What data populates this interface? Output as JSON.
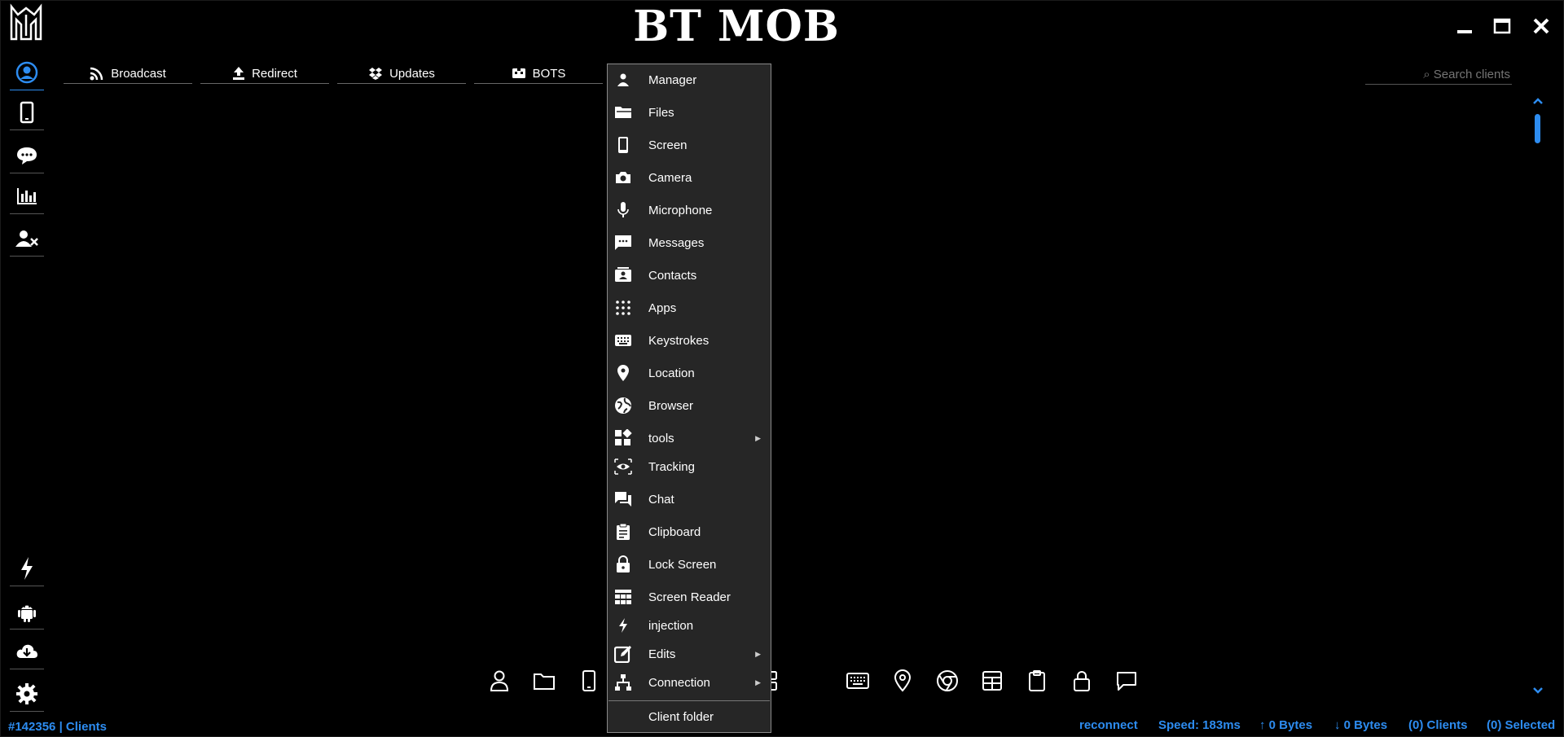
{
  "app": {
    "title": "BT MOB"
  },
  "tabs": [
    {
      "label": "Broadcast",
      "icon": "rss-icon"
    },
    {
      "label": "Redirect",
      "icon": "upload-icon"
    },
    {
      "label": "Updates",
      "icon": "dropbox-icon"
    },
    {
      "label": "BOTS",
      "icon": "bots-icon"
    }
  ],
  "search": {
    "placeholder": "⌕ Search clients"
  },
  "sidebar": {
    "top": [
      {
        "name": "clients",
        "icon": "user-circle-icon",
        "active": true
      },
      {
        "name": "devices",
        "icon": "phone-icon"
      },
      {
        "name": "chat",
        "icon": "chat-bubble-icon"
      },
      {
        "name": "statistics",
        "icon": "bar-chart-icon"
      },
      {
        "name": "blocked-users",
        "icon": "user-remove-icon"
      }
    ],
    "bottom": [
      {
        "name": "injection",
        "icon": "bolt-icon"
      },
      {
        "name": "android",
        "icon": "android-icon"
      },
      {
        "name": "download",
        "icon": "cloud-download-icon"
      },
      {
        "name": "settings",
        "icon": "gear-icon"
      }
    ]
  },
  "context_menu": {
    "items": [
      {
        "label": "Manager",
        "icon": "person-icon"
      },
      {
        "label": "Files",
        "icon": "folder-icon"
      },
      {
        "label": "Screen",
        "icon": "phone-icon"
      },
      {
        "label": "Camera",
        "icon": "camera-icon"
      },
      {
        "label": "Microphone",
        "icon": "microphone-icon"
      },
      {
        "label": "Messages",
        "icon": "message-icon"
      },
      {
        "label": "Contacts",
        "icon": "contacts-icon"
      },
      {
        "label": "Apps",
        "icon": "apps-grid-icon"
      },
      {
        "label": "Keystrokes",
        "icon": "keyboard-icon"
      },
      {
        "label": "Location",
        "icon": "location-pin-icon"
      },
      {
        "label": "Browser",
        "icon": "globe-icon"
      },
      {
        "label": "tools",
        "icon": "widgets-icon",
        "submenu": true
      },
      {
        "label": "Tracking",
        "icon": "eye-icon"
      },
      {
        "label": "Chat",
        "icon": "chat-icon"
      },
      {
        "label": "Clipboard",
        "icon": "clipboard-icon"
      },
      {
        "label": "Lock Screen",
        "icon": "lock-icon"
      },
      {
        "label": "Screen Reader",
        "icon": "table-icon"
      },
      {
        "label": "injection",
        "icon": "bolt-icon"
      },
      {
        "label": "Edits",
        "icon": "edit-icon",
        "submenu": true
      },
      {
        "label": "Connection",
        "icon": "network-icon",
        "submenu": true
      }
    ],
    "footer": {
      "label": "Client folder"
    }
  },
  "bottom_toolbar": [
    "person-icon",
    "folder-icon",
    "phone-icon",
    "apps-grid-icon",
    "keyboard-icon",
    "location-pin-icon",
    "chrome-icon",
    "table-icon",
    "clipboard-icon",
    "lock-icon",
    "chat-bubble-icon"
  ],
  "status": {
    "left": "#142356 | Clients",
    "reconnect": "reconnect",
    "speed": "Speed: 183ms",
    "upload": "↑ 0 Bytes",
    "download": "↓ 0 Bytes",
    "clients": "(0) Clients",
    "selected": "(0) Selected"
  },
  "colors": {
    "accent": "#2d8cf0",
    "background": "#000000",
    "menu_bg": "#262626"
  }
}
